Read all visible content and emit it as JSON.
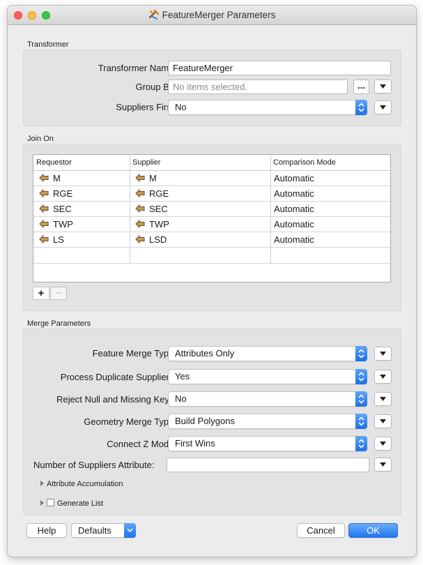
{
  "window": {
    "title": "FeatureMerger Parameters",
    "accent_color": "#2176f0"
  },
  "transformer": {
    "section_label": "Transformer",
    "name_label": "Transformer Name:",
    "name_value": "FeatureMerger",
    "group_by_label": "Group By:",
    "group_by_placeholder": "No items selected.",
    "ellipsis_label": "...",
    "suppliers_first_label": "Suppliers First:",
    "suppliers_first_value": "No"
  },
  "join_on": {
    "section_label": "Join On",
    "columns": [
      "Requestor",
      "Supplier",
      "Comparison Mode"
    ],
    "rows": [
      {
        "requestor": "M",
        "supplier": "M",
        "mode": "Automatic"
      },
      {
        "requestor": "RGE",
        "supplier": "RGE",
        "mode": "Automatic"
      },
      {
        "requestor": "SEC",
        "supplier": "SEC",
        "mode": "Automatic"
      },
      {
        "requestor": "TWP",
        "supplier": "TWP",
        "mode": "Automatic"
      },
      {
        "requestor": "LS",
        "supplier": "LSD",
        "mode": "Automatic"
      }
    ],
    "add_label": "+",
    "remove_label": "−"
  },
  "merge": {
    "section_label": "Merge Parameters",
    "feature_merge_type_label": "Feature Merge Type:",
    "feature_merge_type_value": "Attributes Only",
    "process_duplicate_label": "Process Duplicate Suppliers:",
    "process_duplicate_value": "Yes",
    "reject_null_label": "Reject Null and Missing Keys:",
    "reject_null_value": "No",
    "geometry_merge_type_label": "Geometry Merge Type:",
    "geometry_merge_type_value": "Build Polygons",
    "connect_z_label": "Connect Z Mode:",
    "connect_z_value": "First Wins",
    "num_suppliers_label": "Number of Suppliers Attribute:",
    "num_suppliers_value": "",
    "attr_accumulation_label": "Attribute Accumulation",
    "generate_list_label": "Generate List"
  },
  "footer": {
    "help_label": "Help",
    "defaults_label": "Defaults",
    "cancel_label": "Cancel",
    "ok_label": "OK"
  }
}
